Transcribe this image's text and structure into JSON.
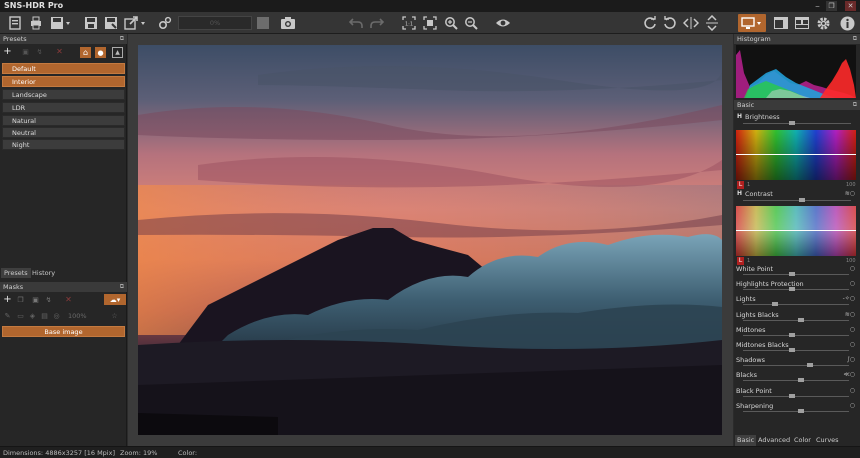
{
  "app": {
    "title": "SNS-HDR Pro"
  },
  "toolbar": {
    "zoom_field": "0%",
    "buttons": [
      "open-file",
      "print",
      "save-dropdown",
      "save",
      "save-as",
      "export-dropdown",
      "settings-gears",
      "stop",
      "snapshot",
      "undo",
      "redo",
      "fit-1-1",
      "fit-window",
      "zoom-in",
      "zoom-out",
      "preview-eye",
      "rotate-right",
      "rotate-left",
      "flip-horizontal",
      "flip-vertical",
      "display-mode",
      "layout-a",
      "layout-b",
      "preferences",
      "info"
    ]
  },
  "presets": {
    "header": "Presets",
    "items": [
      {
        "label": "Default",
        "selected": true
      },
      {
        "label": "Interior",
        "selected": true
      },
      {
        "label": "Landscape",
        "selected": false
      },
      {
        "label": "LDR",
        "selected": false
      },
      {
        "label": "Natural",
        "selected": false
      },
      {
        "label": "Neutral",
        "selected": false
      },
      {
        "label": "Night",
        "selected": false
      }
    ],
    "tabs": [
      "Presets",
      "History"
    ]
  },
  "masks": {
    "header": "Masks",
    "opacity": "100%",
    "base_image": "Base image"
  },
  "histogram": {
    "header": "Histogram"
  },
  "basic": {
    "header": "Basic",
    "brightness": {
      "label": "Brightness",
      "h": "H",
      "value": 0.45
    },
    "contrast": {
      "label": "Contrast",
      "h": "H",
      "value": 0.55
    },
    "gradient_scale": {
      "min": "1",
      "max": "100"
    },
    "gradient_l": "L",
    "sliders": [
      {
        "label": "White Point",
        "value": 0.46,
        "ind": "○"
      },
      {
        "label": "Highlights Protection",
        "value": 0.46,
        "ind": "○"
      },
      {
        "label": "Lights",
        "value": 0.3,
        "ind": "-✧○"
      },
      {
        "label": "Lights Blacks",
        "value": 0.55,
        "ind": "≋○"
      },
      {
        "label": "Midtones",
        "value": 0.46,
        "ind": "○"
      },
      {
        "label": "Midtones Blacks",
        "value": 0.46,
        "ind": "○"
      },
      {
        "label": "Shadows",
        "value": 0.63,
        "ind": "∫○"
      },
      {
        "label": "Blacks",
        "value": 0.55,
        "ind": "≪○"
      },
      {
        "label": "Black Point",
        "value": 0.46,
        "ind": "○"
      },
      {
        "label": "Sharpening",
        "value": 0.55,
        "ind": "○"
      }
    ]
  },
  "right_tabs": [
    "Basic",
    "Advanced",
    "Color",
    "Curves"
  ],
  "status": {
    "dimensions": "Dimensions: 4886x3257 [16 Mpix]",
    "zoom": "Zoom: 19%",
    "color": "Color:"
  },
  "colors": {
    "accent": "#b1662e",
    "panel": "#262626",
    "toolbar": "#353535"
  }
}
